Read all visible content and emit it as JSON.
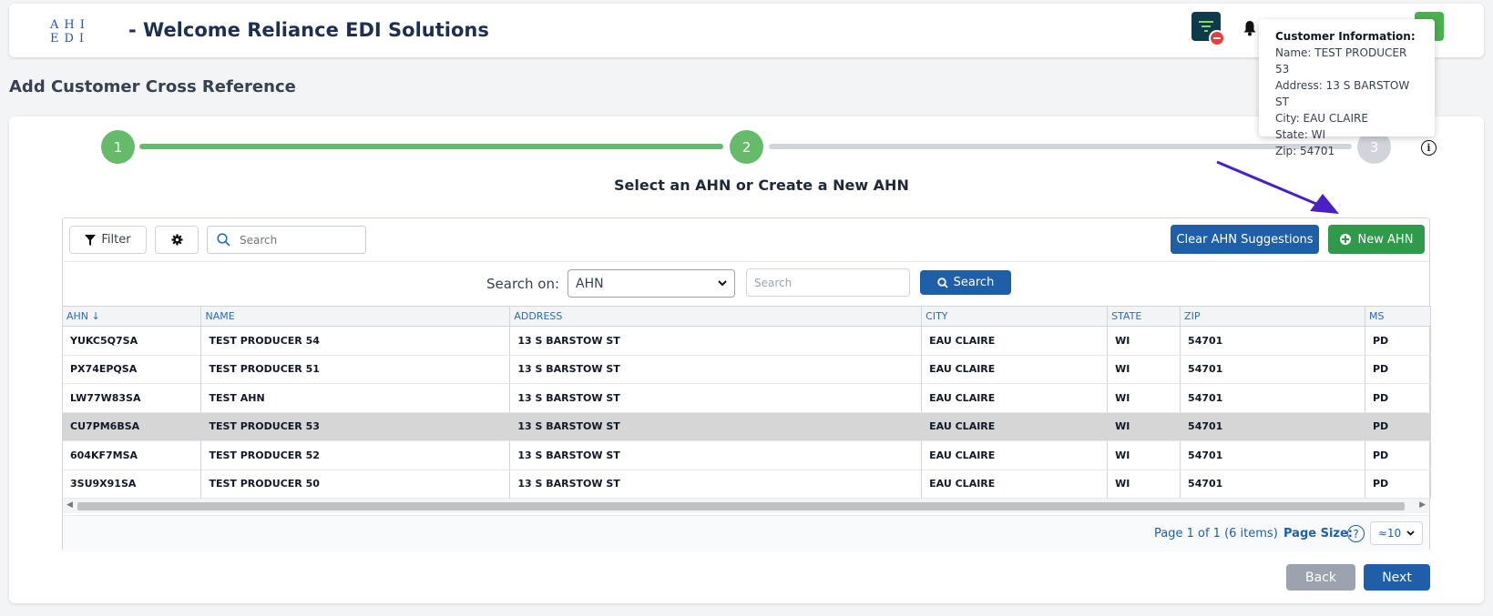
{
  "header": {
    "logo_text": "AHI EDI",
    "title": "- Welcome Reliance EDI Solutions"
  },
  "tooltip": {
    "title": "Customer Information:",
    "name": "Name: TEST PRODUCER 53",
    "address": "Address: 13 S BARSTOW ST",
    "city": "City: EAU CLAIRE",
    "state": "State: WI",
    "zip": "Zip: 54701"
  },
  "page": {
    "heading": "Add Customer Cross Reference"
  },
  "stepper": {
    "steps": [
      "1",
      "2",
      "3"
    ],
    "current": 2
  },
  "subtitle": "Select an AHN or Create a New AHN",
  "toolbar": {
    "filter_label": "Filter",
    "search_placeholder": "Search",
    "clear_label": "Clear AHN Suggestions",
    "new_label": "New AHN"
  },
  "search_on": {
    "label": "Search on:",
    "selected": "AHN",
    "input_placeholder": "Search",
    "button_label": "Search"
  },
  "table": {
    "columns": [
      "AHN ↓",
      "NAME",
      "ADDRESS",
      "CITY",
      "STATE",
      "ZIP",
      "MS"
    ],
    "rows": [
      [
        "YUKC5Q7SA",
        "TEST PRODUCER 54",
        "13 S BARSTOW ST",
        "EAU CLAIRE",
        "WI",
        "54701",
        "PD"
      ],
      [
        "PX74EPQSA",
        "TEST PRODUCER 51",
        "13 S BARSTOW ST",
        "EAU CLAIRE",
        "WI",
        "54701",
        "PD"
      ],
      [
        "LW77W83SA",
        "TEST AHN",
        "13 S BARSTOW ST",
        "EAU CLAIRE",
        "WI",
        "54701",
        "PD"
      ],
      [
        "CU7PM6BSA",
        "TEST PRODUCER 53",
        "13 S BARSTOW ST",
        "EAU CLAIRE",
        "WI",
        "54701",
        "PD"
      ],
      [
        "604KF7MSA",
        "TEST PRODUCER 52",
        "13 S BARSTOW ST",
        "EAU CLAIRE",
        "WI",
        "54701",
        "PD"
      ],
      [
        "3SU9X91SA",
        "TEST PRODUCER 50",
        "13 S BARSTOW ST",
        "EAU CLAIRE",
        "WI",
        "54701",
        "PD"
      ]
    ],
    "selected_row": 3
  },
  "pager": {
    "info": "Page 1 of 1 (6 items)",
    "size_label": "Page Size:",
    "help": "?",
    "size_value": "≈10"
  },
  "footer": {
    "back_label": "Back",
    "next_label": "Next"
  },
  "colors": {
    "primary": "#1f5fa8",
    "success": "#2e9a4a",
    "step_done": "#66bb6a",
    "arrow": "#4a1fc4"
  }
}
